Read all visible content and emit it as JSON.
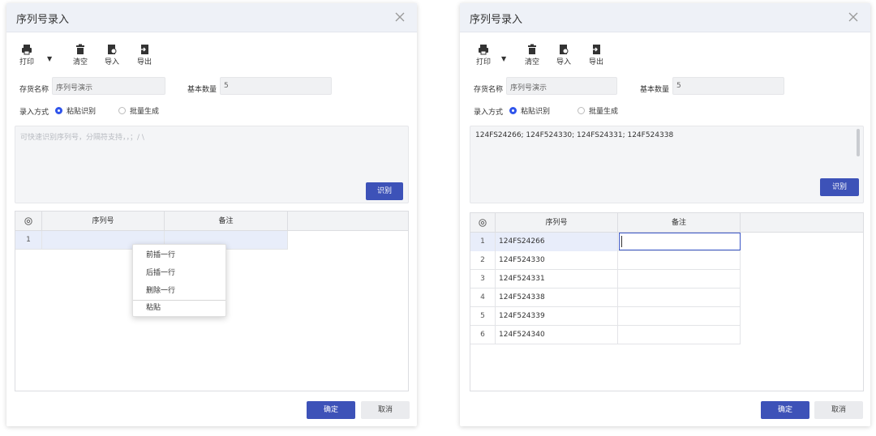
{
  "dialogs": [
    {
      "title": "序列号录入",
      "toolbar": {
        "print": "打印",
        "clear": "清空",
        "import": "导入",
        "export": "导出"
      },
      "form": {
        "name_label": "存货名称",
        "name_value": "序列号演示",
        "qty_label": "基本数量",
        "qty_value": "5",
        "mode_label": "录入方式",
        "mode_paste": "粘贴识别",
        "mode_batch": "批量生成",
        "textarea_placeholder": "可快速识别序列号，分隔符支持，，；/ \\",
        "textarea_value": "",
        "recognize_button": "识别"
      },
      "table": {
        "headers": [
          "序列号",
          "备注"
        ],
        "rows": [
          {
            "num": "1",
            "serial": "",
            "note": ""
          }
        ]
      },
      "context_menu": [
        "前插一行",
        "后插一行",
        "删除一行",
        "粘贴"
      ],
      "footer": {
        "ok": "确定",
        "cancel": "取消"
      }
    },
    {
      "title": "序列号录入",
      "toolbar": {
        "print": "打印",
        "clear": "清空",
        "import": "导入",
        "export": "导出"
      },
      "form": {
        "name_label": "存货名称",
        "name_value": "序列号演示",
        "qty_label": "基本数量",
        "qty_value": "5",
        "mode_label": "录入方式",
        "mode_paste": "粘贴识别",
        "mode_batch": "批量生成",
        "textarea_placeholder": "",
        "textarea_value": "124FS24266; 124F524330; 124FS24331; 124F524338",
        "recognize_button": "识别"
      },
      "table": {
        "headers": [
          "序列号",
          "备注"
        ],
        "rows": [
          {
            "num": "1",
            "serial": "124FS24266",
            "note": ""
          },
          {
            "num": "2",
            "serial": "124F524330",
            "note": ""
          },
          {
            "num": "3",
            "serial": "124F524331",
            "note": ""
          },
          {
            "num": "4",
            "serial": "124F524338",
            "note": ""
          },
          {
            "num": "5",
            "serial": "124F524339",
            "note": ""
          },
          {
            "num": "6",
            "serial": "124F524340",
            "note": ""
          }
        ]
      },
      "footer": {
        "ok": "确定",
        "cancel": "取消"
      }
    }
  ],
  "colors": {
    "primary": "#3d52b8",
    "titlebar": "#eef1f7",
    "selected_row": "#e8edfa"
  },
  "icons": [
    "close-icon",
    "printer-icon",
    "caret-down-icon",
    "trash-icon",
    "import-icon",
    "export-icon",
    "gear-icon"
  ]
}
